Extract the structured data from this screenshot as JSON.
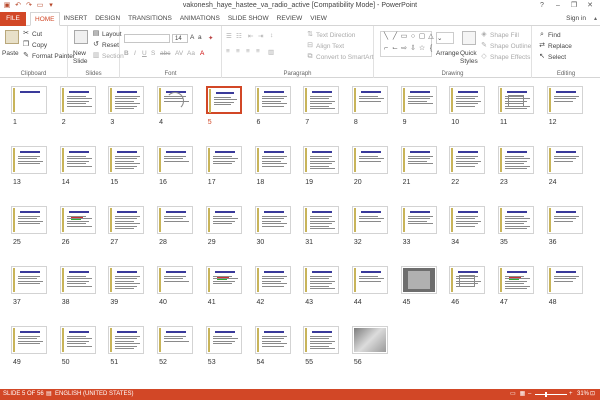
{
  "title_bar": {
    "title": "vakonesh_haye_hastee_va_radio_active [Compatibility Mode] - PowerPoint",
    "qat": [
      "save-icon",
      "undo-icon",
      "redo-icon",
      "start-icon",
      "customize-icon"
    ],
    "controls": [
      "?",
      "–",
      "❐",
      "✕"
    ]
  },
  "tabs": {
    "file": "FILE",
    "items": [
      "HOME",
      "INSERT",
      "DESIGN",
      "TRANSITIONS",
      "ANIMATIONS",
      "SLIDE SHOW",
      "REVIEW",
      "VIEW"
    ],
    "active": "HOME",
    "sign_in": "Sign in"
  },
  "ribbon": {
    "clipboard": {
      "label": "Clipboard",
      "paste": "Paste",
      "cut": "Cut",
      "copy": "Copy",
      "format_painter": "Format Painter"
    },
    "slides": {
      "label": "Slides",
      "new_slide": "New",
      "new_slide2": "Slide",
      "layout": "Layout",
      "reset": "Reset",
      "section": "Section"
    },
    "font": {
      "label": "Font",
      "size": "14",
      "bold": "B",
      "italic": "I",
      "underline": "U",
      "shadow": "S",
      "strike": "abc",
      "spacing": "AV",
      "case": "Aa",
      "color": "A"
    },
    "paragraph": {
      "label": "Paragraph",
      "text_direction": "Text Direction",
      "align_text": "Align Text",
      "convert_smartart": "Convert to SmartArt"
    },
    "drawing": {
      "label": "Drawing",
      "arrange": "Arrange",
      "quick_styles": "Quick",
      "quick_styles2": "Styles",
      "shape_fill": "Shape Fill",
      "shape_outline": "Shape Outline",
      "shape_effects": "Shape Effects"
    },
    "editing": {
      "label": "Editing",
      "find": "Find",
      "replace": "Replace",
      "select": "Select"
    }
  },
  "slides": {
    "count": 56,
    "selected": 5,
    "numbers": [
      "1",
      "2",
      "3",
      "4",
      "5",
      "6",
      "7",
      "8",
      "9",
      "10",
      "11",
      "12",
      "13",
      "14",
      "15",
      "16",
      "17",
      "18",
      "19",
      "20",
      "21",
      "22",
      "23",
      "24",
      "25",
      "26",
      "27",
      "28",
      "29",
      "30",
      "31",
      "32",
      "33",
      "34",
      "35",
      "36",
      "37",
      "38",
      "39",
      "40",
      "41",
      "42",
      "43",
      "44",
      "45",
      "46",
      "47",
      "48",
      "49",
      "50",
      "51",
      "52",
      "53",
      "54",
      "55",
      "56"
    ]
  },
  "status": {
    "slide": "SLIDE 5 OF 56",
    "language": "ENGLISH (UNITED STATES)",
    "zoom": "31%"
  },
  "colors": {
    "accent": "#d24726",
    "status_bar": "#d24726"
  }
}
